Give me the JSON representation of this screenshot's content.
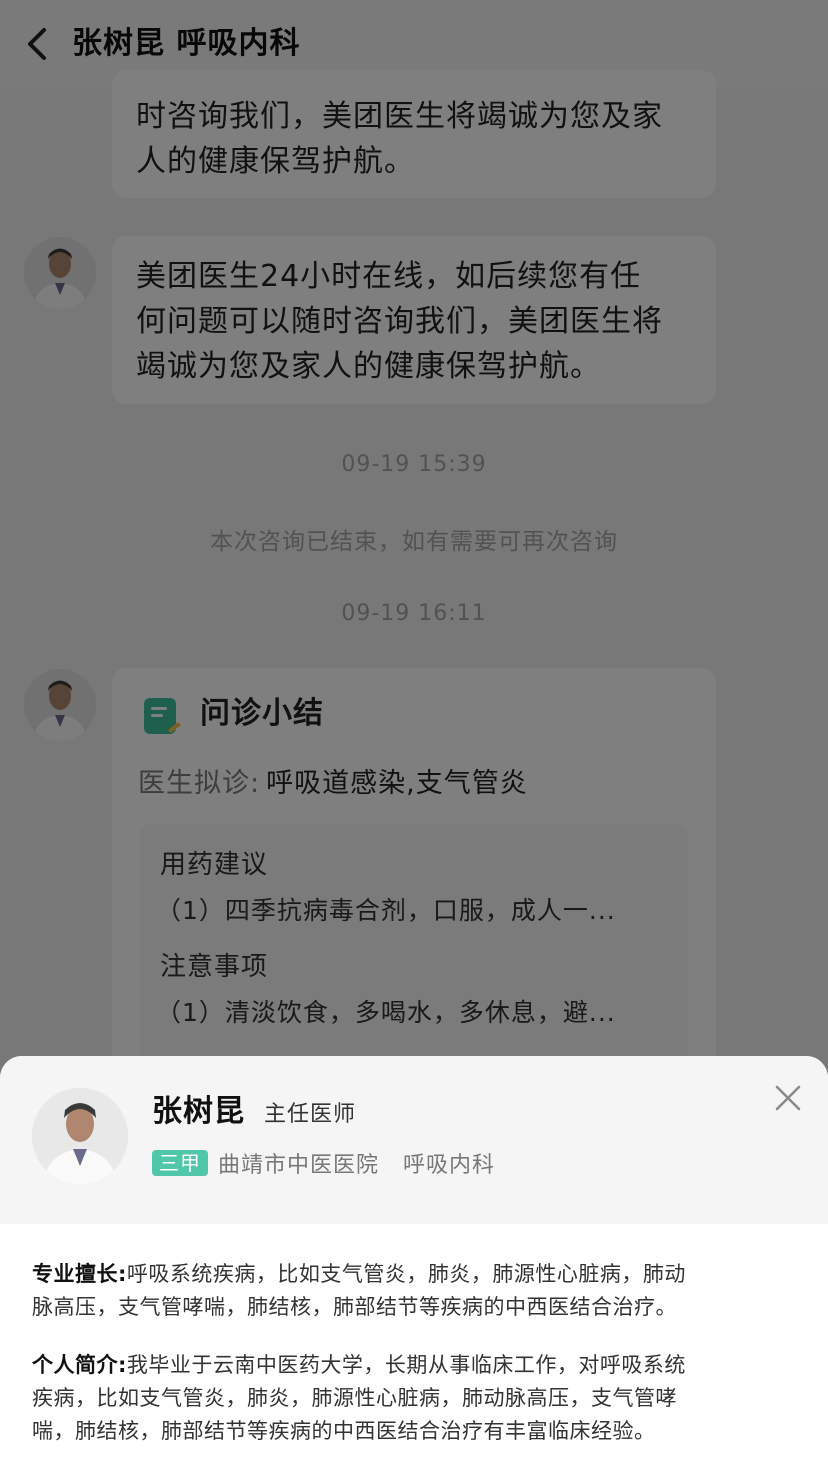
{
  "header": {
    "title": "张树昆 呼吸内科"
  },
  "messages": [
    {
      "lines": [
        "时咨询我们，美团医生将竭诚为您及家",
        "人的健康保驾护航。"
      ]
    },
    {
      "lines": [
        "美团医生24小时在线，如后续您有任",
        "何问题可以随时咨询我们，美团医生将",
        "竭诚为您及家人的健康保驾护航。"
      ]
    }
  ],
  "timestamps": [
    "09-19 15:39",
    "09-19 16:11"
  ],
  "system_notice": "本次咨询已结束，如有需要可再次咨询",
  "summary": {
    "title": "问诊小结",
    "diagnosis_label": "医生拟诊:",
    "diagnosis_value": "呼吸道感染,支气管炎",
    "medication_heading": "用药建议",
    "medication_item": "（1）四季抗病毒合剂，口服，成人一...",
    "notes_heading": "注意事项",
    "notes_item": "（1）清淡饮食，多喝水，多休息，避..."
  },
  "doctor_card": {
    "name": "张树昆",
    "title": "主任医师",
    "hospital_grade": "三甲",
    "hospital": "曲靖市中医医院",
    "department": "呼吸内科",
    "specialty_label": "专业擅长:",
    "specialty_lines": [
      "呼吸系统疾病，比如支气管炎，肺炎，肺源性心脏病，肺动",
      "脉高压，支气管哮喘，肺结核，肺部结节等疾病的中西医结合治疗。"
    ],
    "bio_label": "个人简介:",
    "bio_lines": [
      "我毕业于云南中医药大学，长期从事临床工作，对呼吸系统",
      "疾病，比如支气管炎，肺炎，肺源性心脏病，肺动脉高压，支气管哮",
      "喘，肺结核，肺部结节等疾病的中西医结合治疗有丰富临床经验。"
    ]
  },
  "colors": {
    "badge_green": "#4fc7a8",
    "overlay": "rgba(0,0,0,0.5)"
  },
  "icons": {
    "back": "chevron-left-icon",
    "summary": "document-icon",
    "close": "close-icon"
  }
}
